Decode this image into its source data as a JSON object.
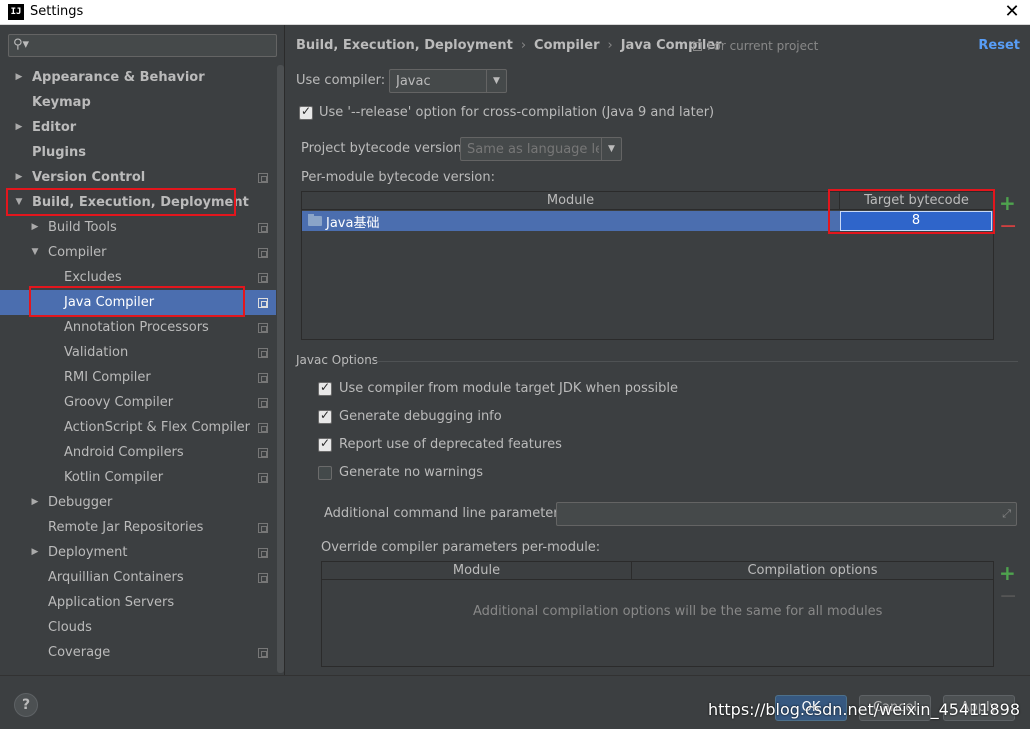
{
  "window": {
    "title": "Settings",
    "app_icon": "IJ"
  },
  "sidebar": {
    "search_placeholder": "",
    "items": [
      {
        "label": "Appearance & Behavior",
        "bold": true,
        "arrow": "▶"
      },
      {
        "label": "Keymap",
        "bold": true,
        "arrow": ""
      },
      {
        "label": "Editor",
        "bold": true,
        "arrow": "▶"
      },
      {
        "label": "Plugins",
        "bold": true,
        "arrow": ""
      },
      {
        "label": "Version Control",
        "bold": true,
        "arrow": "▶"
      },
      {
        "label": "Build, Execution, Deployment",
        "bold": true,
        "arrow": "▼"
      },
      {
        "label": "Build Tools",
        "arrow": "▶"
      },
      {
        "label": "Compiler",
        "arrow": "▼"
      },
      {
        "label": "Excludes",
        "arrow": ""
      },
      {
        "label": "Java Compiler",
        "arrow": ""
      },
      {
        "label": "Annotation Processors",
        "arrow": ""
      },
      {
        "label": "Validation",
        "arrow": ""
      },
      {
        "label": "RMI Compiler",
        "arrow": ""
      },
      {
        "label": "Groovy Compiler",
        "arrow": ""
      },
      {
        "label": "ActionScript & Flex Compiler",
        "arrow": ""
      },
      {
        "label": "Android Compilers",
        "arrow": ""
      },
      {
        "label": "Kotlin Compiler",
        "arrow": ""
      },
      {
        "label": "Debugger",
        "arrow": "▶"
      },
      {
        "label": "Remote Jar Repositories",
        "arrow": ""
      },
      {
        "label": "Deployment",
        "arrow": "▶"
      },
      {
        "label": "Arquillian Containers",
        "arrow": ""
      },
      {
        "label": "Application Servers",
        "arrow": ""
      },
      {
        "label": "Clouds",
        "arrow": ""
      },
      {
        "label": "Coverage",
        "arrow": ""
      }
    ]
  },
  "main": {
    "breadcrumb": [
      "Build, Execution, Deployment",
      "Compiler",
      "Java Compiler"
    ],
    "breadcrumb_sep": "›",
    "for_project": "For current project",
    "reset": "Reset",
    "use_compiler_label": "Use compiler:",
    "use_compiler_value": "Javac",
    "release_option": "Use '--release' option for cross-compilation (Java 9 and later)",
    "project_bytecode_label": "Project bytecode version:",
    "project_bytecode_value": "Same as language level",
    "per_module_label": "Per-module bytecode version:",
    "module_table": {
      "col_module": "Module",
      "col_target": "Target bytecode version",
      "rows": [
        {
          "module": "Java基础",
          "target": "8"
        }
      ]
    },
    "javac_options_title": "Javac Options",
    "options": {
      "use_module_jdk": "Use compiler from module target JDK when possible",
      "debug_info": "Generate debugging info",
      "deprecated": "Report use of deprecated features",
      "no_warnings": "Generate no warnings"
    },
    "additional_params_label": "Additional command line parameters:",
    "override_label": "Override compiler parameters per-module:",
    "override_table": {
      "col_module": "Module",
      "col_options": "Compilation options",
      "empty_text": "Additional compilation options will be the same for all modules"
    }
  },
  "footer": {
    "help": "?",
    "ok": "OK",
    "cancel": "Cancel",
    "apply": "Apply",
    "watermark": "https://blog.csdn.net/weixin_45411898"
  },
  "colors": {
    "selection": "#4b6eaf",
    "accent_link": "#589df6",
    "highlight_box": "#e3161d"
  }
}
